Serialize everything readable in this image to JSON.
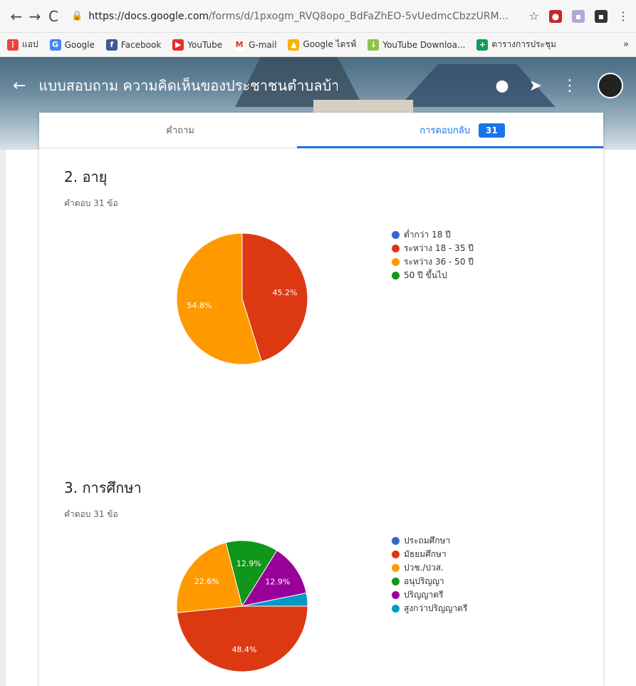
{
  "browser": {
    "url_main": "https://docs.google.com",
    "url_rest": "/forms/d/1pxogm_RVQ8opo_BdFaZhEO-5vUedmcCbzzURM..."
  },
  "bookmarks": [
    {
      "label": "แอป",
      "icon": "apps-grid-icon",
      "color": "#e8453c"
    },
    {
      "label": "Google",
      "icon": "google-g-icon",
      "color": "#4285f4"
    },
    {
      "label": "Facebook",
      "icon": "facebook-icon",
      "color": "#3b5998"
    },
    {
      "label": "YouTube",
      "icon": "youtube-icon",
      "color": "#e52d27"
    },
    {
      "label": "G-mail",
      "icon": "gmail-icon",
      "color": "#d93025"
    },
    {
      "label": "Google ไดรฟ์",
      "icon": "drive-icon",
      "color": "#f4b400"
    },
    {
      "label": "YouTube Downloa...",
      "icon": "download-icon",
      "color": "#8bc34a"
    },
    {
      "label": "ตารางการประชุม",
      "icon": "calendar-plus-icon",
      "color": "#0f9d58"
    }
  ],
  "header": {
    "title": "แบบสอบถาม ความคิดเห็นของประชาชนตำบลบ้า"
  },
  "tabs": {
    "questions": "คำถาม",
    "responses": "การตอบกลับ",
    "count": "31"
  },
  "questions": [
    {
      "title": "2. อายุ",
      "sub": "คำตอบ 31 ข้อ"
    },
    {
      "title": "3. การศึกษา",
      "sub": "คำตอบ 31 ข้อ"
    }
  ],
  "chart_data": [
    {
      "type": "pie",
      "categories": [
        "ต่ำกว่า 18 ปี",
        "ระหว่าง 18 - 35 ปี",
        "ระหว่าง 36 - 50 ปี",
        "50 ปี ขึ้นไป"
      ],
      "values": [
        0,
        45.2,
        54.8,
        0
      ],
      "colors": [
        "#3366cc",
        "#dc3912",
        "#ff9900",
        "#109618"
      ],
      "labels_shown": [
        "",
        "45.2%",
        "54.8%",
        ""
      ],
      "legend": "right"
    },
    {
      "type": "pie",
      "categories": [
        "ประถมศึกษา",
        "มัธยมศึกษา",
        "ปวช./ปวส.",
        "อนุปริญญา",
        "ปริญญาตรี",
        "สูงกว่าปริญญาตรี"
      ],
      "values": [
        0,
        48.4,
        22.6,
        12.9,
        12.9,
        3.2
      ],
      "colors": [
        "#3366cc",
        "#dc3912",
        "#ff9900",
        "#109618",
        "#990099",
        "#0099c6"
      ],
      "labels_shown": [
        "",
        "48.4%",
        "22.6%",
        "12.9%",
        "12.9%",
        ""
      ],
      "legend": "right"
    }
  ]
}
